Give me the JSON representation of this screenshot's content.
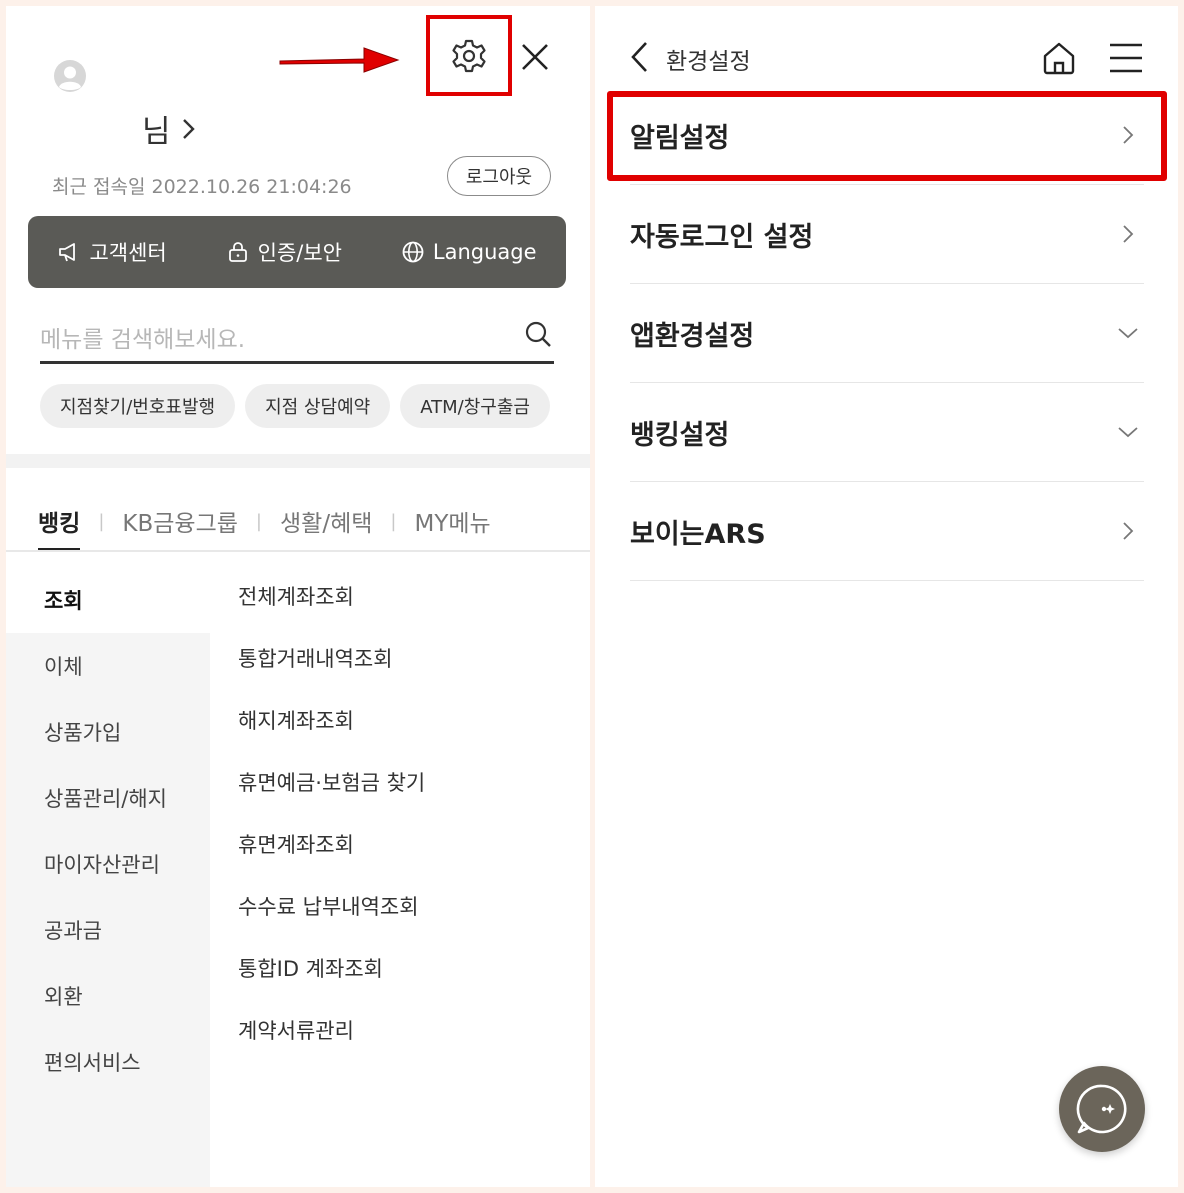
{
  "menu_panel": {
    "user_name_suffix": "님",
    "last_login": "최근 접속일 2022.10.26 21:04:26",
    "logout_label": "로그아웃",
    "quick_links": [
      {
        "label": "고객센터",
        "icon": "megaphone-icon"
      },
      {
        "label": "인증/보안",
        "icon": "lock-icon"
      },
      {
        "label": "Language",
        "icon": "globe-icon"
      }
    ],
    "search": {
      "placeholder": "메뉴를 검색해보세요."
    },
    "chips": [
      "지점찾기/번호표발행",
      "지점 상담예약",
      "ATM/창구출금"
    ],
    "tabs": [
      "뱅킹",
      "KB금융그룹",
      "생활/혜택",
      "MY메뉴"
    ],
    "active_tab": 0,
    "categories": [
      "조회",
      "이체",
      "상품가입",
      "상품관리/해지",
      "마이자산관리",
      "공과금",
      "외환",
      "편의서비스"
    ],
    "active_category": 0,
    "submenu": [
      "전체계좌조회",
      "통합거래내역조회",
      "해지계좌조회",
      "휴면예금·보험금 찾기",
      "휴면계좌조회",
      "수수료 납부내역조회",
      "통합ID 계좌조회",
      "계약서류관리"
    ]
  },
  "settings_panel": {
    "title": "환경설정",
    "items": [
      {
        "label": "알림설정",
        "indicator": "chevron-right"
      },
      {
        "label": "자동로그인 설정",
        "indicator": "chevron-right"
      },
      {
        "label": "앱환경설정",
        "indicator": "chevron-down"
      },
      {
        "label": "뱅킹설정",
        "indicator": "chevron-down"
      },
      {
        "label": "보이는ARS",
        "indicator": "chevron-right"
      }
    ]
  },
  "colors": {
    "highlight": "#e00000",
    "quickbar_bg": "#5a5a56",
    "chat_button": "#6b655a",
    "page_bg": "#fdf1ea"
  }
}
